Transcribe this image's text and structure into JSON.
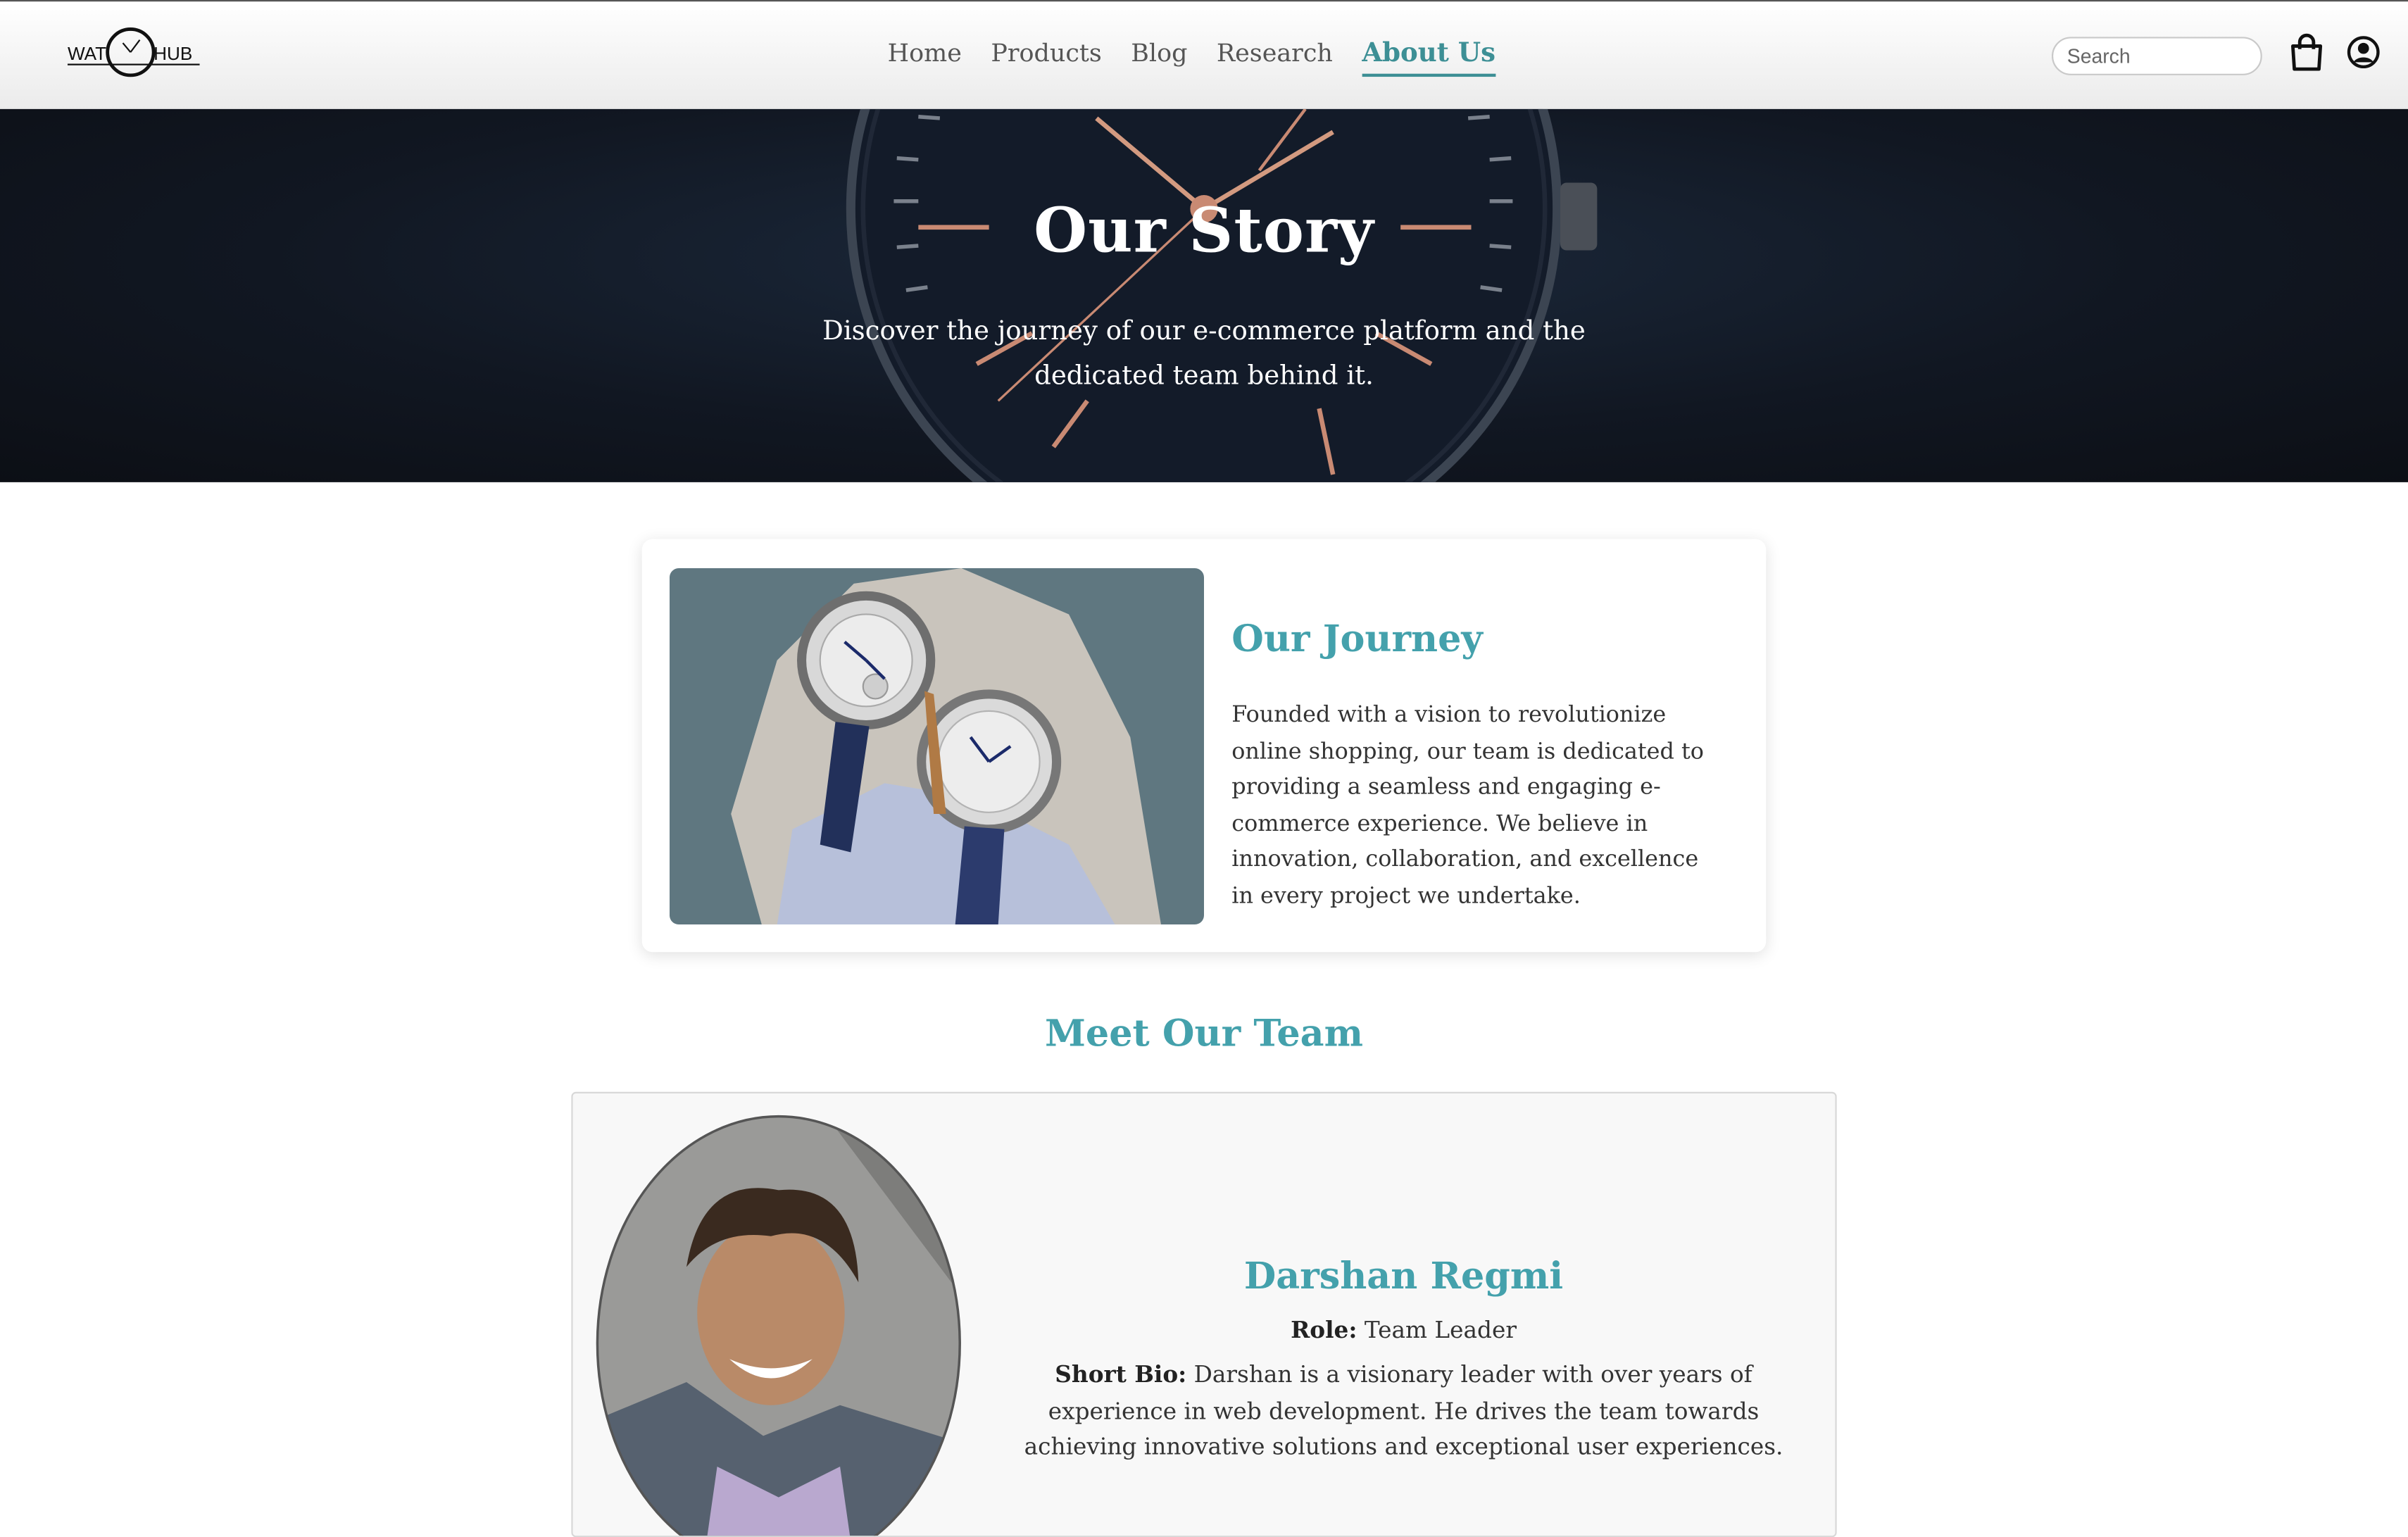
{
  "brand": {
    "logo_left": "WAT",
    "logo_right": "HUB"
  },
  "nav": {
    "items": [
      {
        "label": "Home"
      },
      {
        "label": "Products"
      },
      {
        "label": "Blog"
      },
      {
        "label": "Research"
      },
      {
        "label": "About Us",
        "active": true
      }
    ],
    "search_placeholder": "Search",
    "cart_icon": "shopping-bag-icon",
    "account_icon": "user-account-icon"
  },
  "hero": {
    "title": "Our Story",
    "subtitle": "Discover the journey of our e-commerce platform and the dedicated team behind it."
  },
  "journey": {
    "title": "Our Journey",
    "text": "Founded with a vision to revolutionize online shopping, our team is dedicated to providing a seamless and engaging e-commerce experience. We believe in innovation, collaboration, and excellence in every project we undertake."
  },
  "team": {
    "heading": "Meet Our Team",
    "members": [
      {
        "name": "Darshan Regmi",
        "role_label": "Role:",
        "role": "Team Leader",
        "bio_label": "Short Bio:",
        "bio": "Darshan is a visionary leader with over years of experience in web development. He drives the team towards achieving innovative solutions and exceptional user experiences."
      }
    ]
  },
  "colors": {
    "accent": "#44a1ac",
    "nav_active": "#3d8f95",
    "hero_bg": "#111722"
  }
}
